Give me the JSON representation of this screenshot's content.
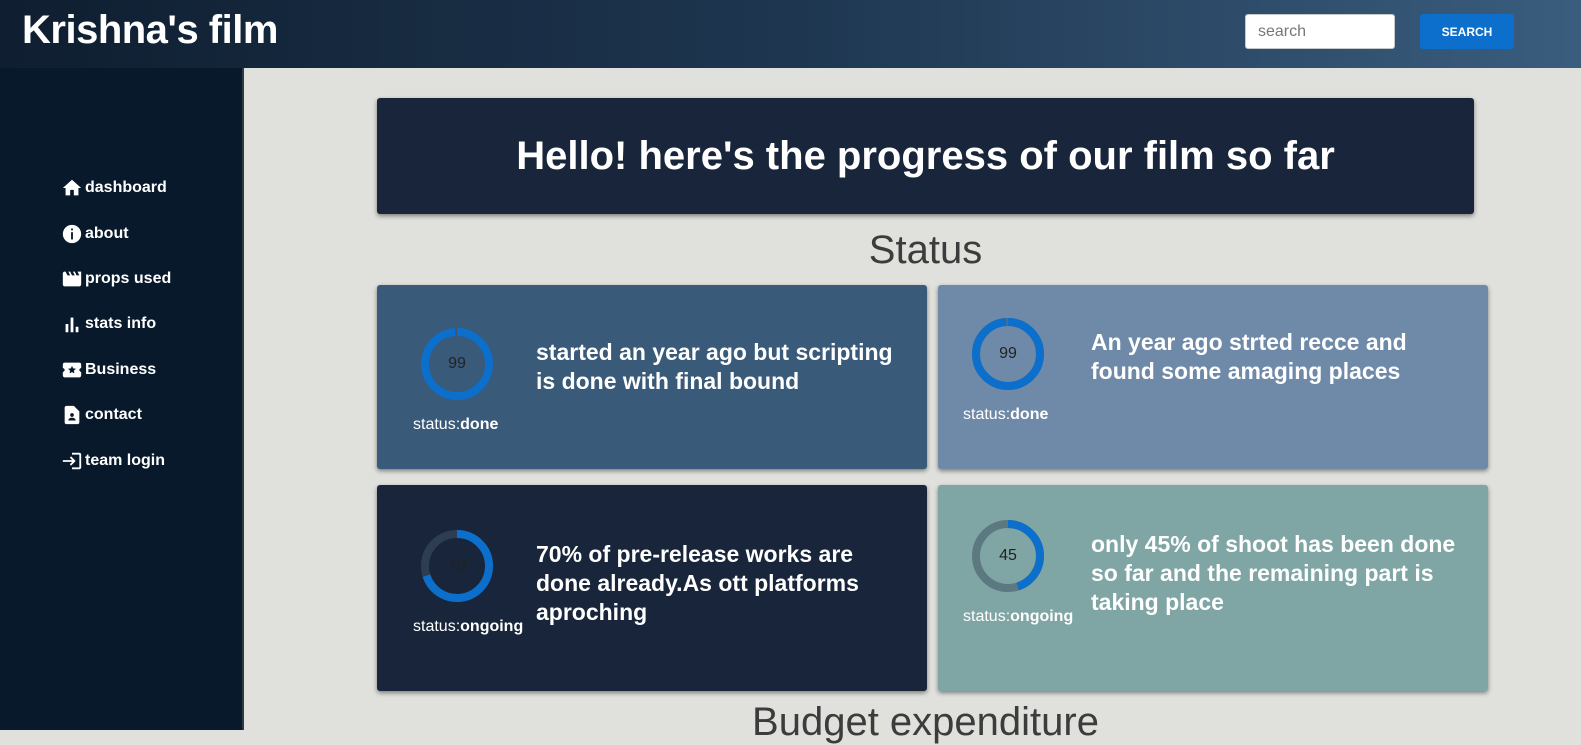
{
  "header": {
    "brand": "Krishna's film",
    "search_placeholder": "search",
    "search_button": "SEARCH"
  },
  "sidebar": {
    "items": [
      {
        "label": "dashboard",
        "icon": "home-icon"
      },
      {
        "label": "about",
        "icon": "info-icon"
      },
      {
        "label": "props used",
        "icon": "clapperboard-icon"
      },
      {
        "label": "stats info",
        "icon": "bar-chart-icon"
      },
      {
        "label": "Business",
        "icon": "ticket-star-icon"
      },
      {
        "label": "contact",
        "icon": "contact-card-icon"
      },
      {
        "label": "team login",
        "icon": "login-icon"
      }
    ]
  },
  "banner": {
    "title": "Hello! here's the progress of our film so far"
  },
  "status_section": {
    "heading": "Status",
    "status_prefix": "status:",
    "cards": [
      {
        "progress": 99,
        "status": "done",
        "text": "started an year ago but scripting is done with final bound",
        "bg": "#3a5a7a"
      },
      {
        "progress": 99,
        "status": "done",
        "text": "An year ago strted recce and found some amaging places",
        "bg": "#6e8aa8"
      },
      {
        "progress": 70,
        "status": "ongoing",
        "text": "70% of pre-release works are done already.As ott platforms aproching",
        "bg": "#18253a"
      },
      {
        "progress": 45,
        "status": "ongoing",
        "text": "only 45% of shoot has been done so far and the remaining part is taking place",
        "bg": "#7fa6a4"
      }
    ]
  },
  "budget_section": {
    "heading": "Budget expenditure"
  },
  "colors": {
    "accent": "#0b6fcb",
    "ring_track": "#3f5366",
    "sidebar_bg": "#07192a",
    "page_bg": "#e0e0dc"
  }
}
